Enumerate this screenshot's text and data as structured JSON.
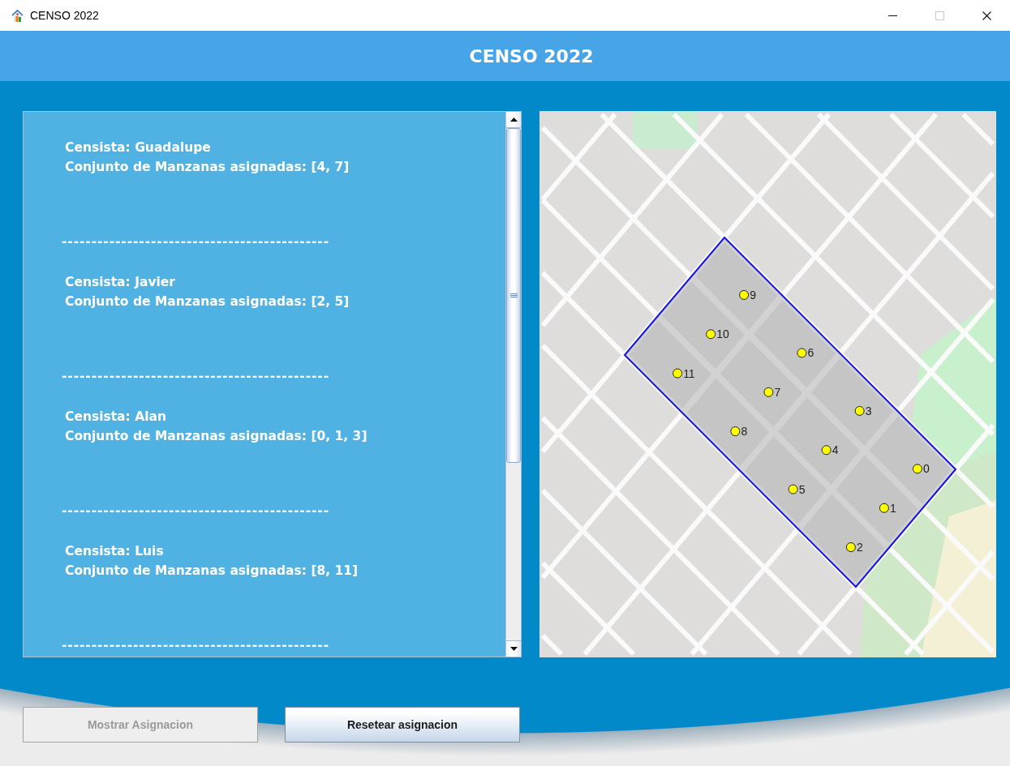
{
  "window": {
    "title": "CENSO 2022",
    "controls": [
      {
        "kind": "minimize",
        "disabled": false
      },
      {
        "kind": "maximize",
        "disabled": true
      },
      {
        "kind": "close",
        "disabled": false
      }
    ]
  },
  "header": {
    "title": "CENSO 2022"
  },
  "assignments": {
    "entries": [
      {
        "census_taker": "Censista: Guadalupe",
        "blocks": "Conjunto de Manzanas asignadas: [4, 7]",
        "separator": "---------------------------------------------"
      },
      {
        "census_taker": "Censista: Javier",
        "blocks": "Conjunto de Manzanas asignadas: [2, 5]",
        "separator": "---------------------------------------------"
      },
      {
        "census_taker": "Censista: Alan",
        "blocks": "Conjunto de Manzanas asignadas: [0, 1, 3]",
        "separator": "---------------------------------------------"
      },
      {
        "census_taker": "Censista: Luis",
        "blocks": "Conjunto de Manzanas asignadas: [8, 11]",
        "separator": "---------------------------------------------"
      }
    ]
  },
  "map": {
    "blocks": [
      {
        "label": "0"
      },
      {
        "label": "1"
      },
      {
        "label": "2"
      },
      {
        "label": "3"
      },
      {
        "label": "4"
      },
      {
        "label": "5"
      },
      {
        "label": "6"
      },
      {
        "label": "7"
      },
      {
        "label": "8"
      },
      {
        "label": "9"
      },
      {
        "label": "10"
      },
      {
        "label": "11"
      }
    ]
  },
  "buttons": [
    {
      "label": "Mostrar Asignacion",
      "disabled": true
    },
    {
      "label": "Resetear asignacion",
      "disabled": false
    }
  ]
}
